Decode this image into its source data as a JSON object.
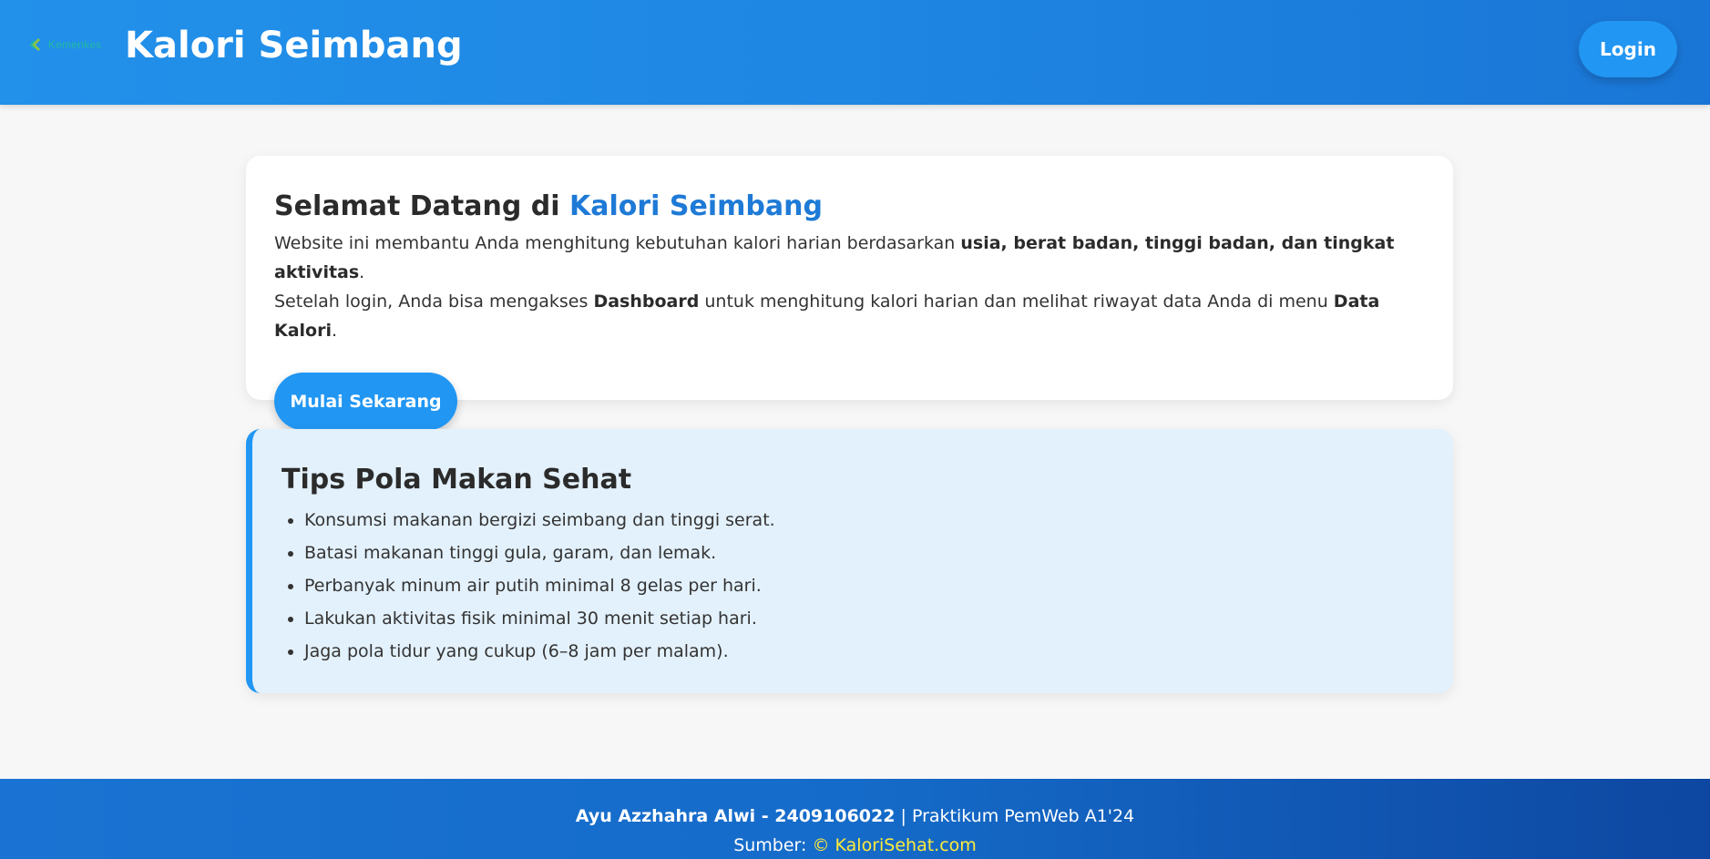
{
  "header": {
    "logo_text": "Kemenkes",
    "title": "Kalori Seimbang",
    "login_label": "Login"
  },
  "welcome": {
    "title_prefix": "Selamat Datang di",
    "title_brand": "Kalori Seimbang",
    "line1_a": "Website ini membantu Anda menghitung kebutuhan kalori harian berdasarkan",
    "line1_bold": "usia, berat badan, tinggi badan, dan tingkat aktivitas",
    "line1_end": ".",
    "line2_a": "Setelah login, Anda bisa mengakses",
    "line2_bold1": "Dashboard",
    "line2_b": "untuk menghitung kalori harian dan melihat riwayat data Anda di menu",
    "line2_bold2": "Data Kalori",
    "line2_end": ".",
    "button_label": "Mulai Sekarang"
  },
  "tips": {
    "title": "Tips Pola Makan Sehat",
    "items": [
      "Konsumsi makanan bergizi seimbang dan tinggi serat.",
      "Batasi makanan tinggi gula, garam, dan lemak.",
      "Perbanyak minum air putih minimal 8 gelas per hari.",
      "Lakukan aktivitas fisik minimal 30 menit setiap hari.",
      "Jaga pola tidur yang cukup (6–8 jam per malam)."
    ]
  },
  "footer": {
    "author": "Ayu Azzhahra Alwi - 2409106022",
    "separator": "|",
    "course": "Praktikum PemWeb A1'24",
    "source_label": "Sumber:",
    "source_link": "© KaloriSehat.com"
  },
  "colors": {
    "header_blue": "#1e86e3",
    "accent_blue": "#2196f3",
    "brand_text": "#1e7ad6",
    "tips_bg": "#e3f1fc",
    "footer_dark": "#0d47a1",
    "link_yellow": "#ffeb3b"
  }
}
